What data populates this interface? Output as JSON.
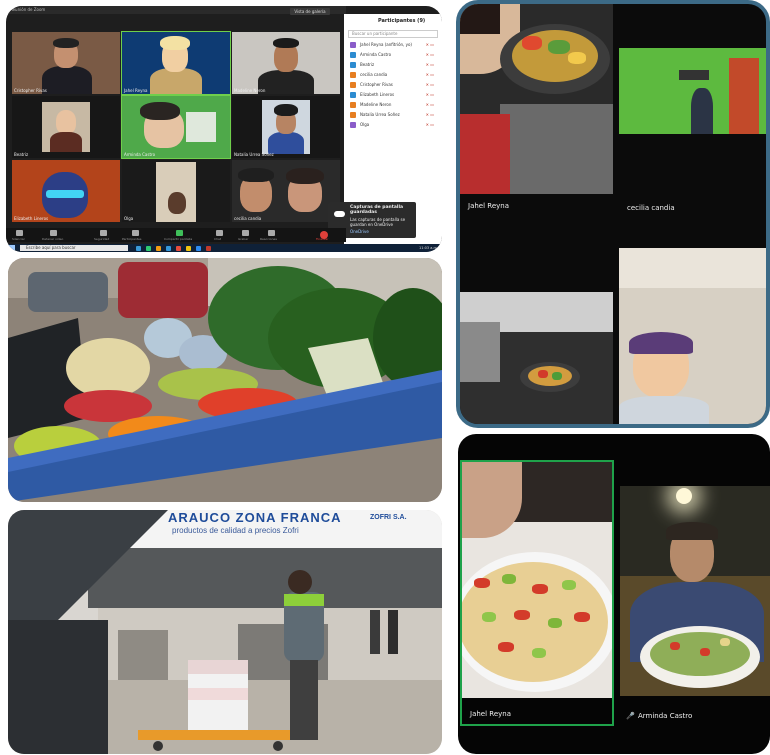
{
  "zoom_meeting": {
    "window_title": "Reunión de Zoom",
    "view_button": "Vista de galería",
    "participants_header": "Participantes (9)",
    "participant_search": "Buscar un participante",
    "participants": [
      {
        "name": "Jahel Reyna (anfitrión, yo)",
        "color": "#8a5cc9"
      },
      {
        "name": "Arminda Castro",
        "color": "#2d8cd0"
      },
      {
        "name": "Beatriz",
        "color": "#2d8cd0"
      },
      {
        "name": "cecilia candia",
        "color": "#e67e22"
      },
      {
        "name": "Cristopher Rivas",
        "color": "#e67e22"
      },
      {
        "name": "Elizabeth Lineros",
        "color": "#2d8cd0"
      },
      {
        "name": "Madeline Neron",
        "color": "#e67e22"
      },
      {
        "name": "Natalia Urrea Soñez",
        "color": "#e67e22"
      },
      {
        "name": "Olga",
        "color": "#8a5cc9"
      }
    ],
    "mic_status": "Silenciar",
    "tiles": [
      {
        "name": "Cristopher Rivas"
      },
      {
        "name": "Jahel Reyna"
      },
      {
        "name": "Madeline Neron"
      },
      {
        "name": "Beatriz"
      },
      {
        "name": "Arminda Castro"
      },
      {
        "name": "Natalia Urrea Soñez"
      },
      {
        "name": "Elizabeth Lineros"
      },
      {
        "name": "Olga"
      },
      {
        "name": "cecilia candia"
      }
    ],
    "toast": {
      "title": "Capturas de pantalla guardadas",
      "body": "Las capturas de pantalla se guardan en OneDrive",
      "link": "OneDrive"
    },
    "toolbar": [
      "Silenciar",
      "Detener video",
      "Seguridad",
      "Participantes",
      "Compartir pantalla",
      "Chat",
      "Grabar",
      "Reacciones"
    ],
    "end_label": "Finalizar",
    "taskbar_search": "Escribe aquí para buscar",
    "clock": "11:03 a.m."
  },
  "kitchen_call": {
    "tiles": [
      {
        "name": "Jahel Reyna"
      },
      {
        "name": "cecilia candia"
      },
      {
        "name": ""
      },
      {
        "name": ""
      }
    ]
  },
  "delivery_photo": {
    "store_sign": "ARAUCO ZONA FRANCA",
    "store_subtitle": "productos de calidad a precios Zofri",
    "store_tag": "ZOFRI S.A."
  },
  "salad_call": {
    "tiles": [
      {
        "name": "Jahel Reyna"
      },
      {
        "name": "Arminda Castro"
      }
    ]
  },
  "colors": {
    "kitchen_border": "#3c6a86",
    "salad_active_border": "#1fa24a",
    "zoom_end": "#e0403a"
  }
}
